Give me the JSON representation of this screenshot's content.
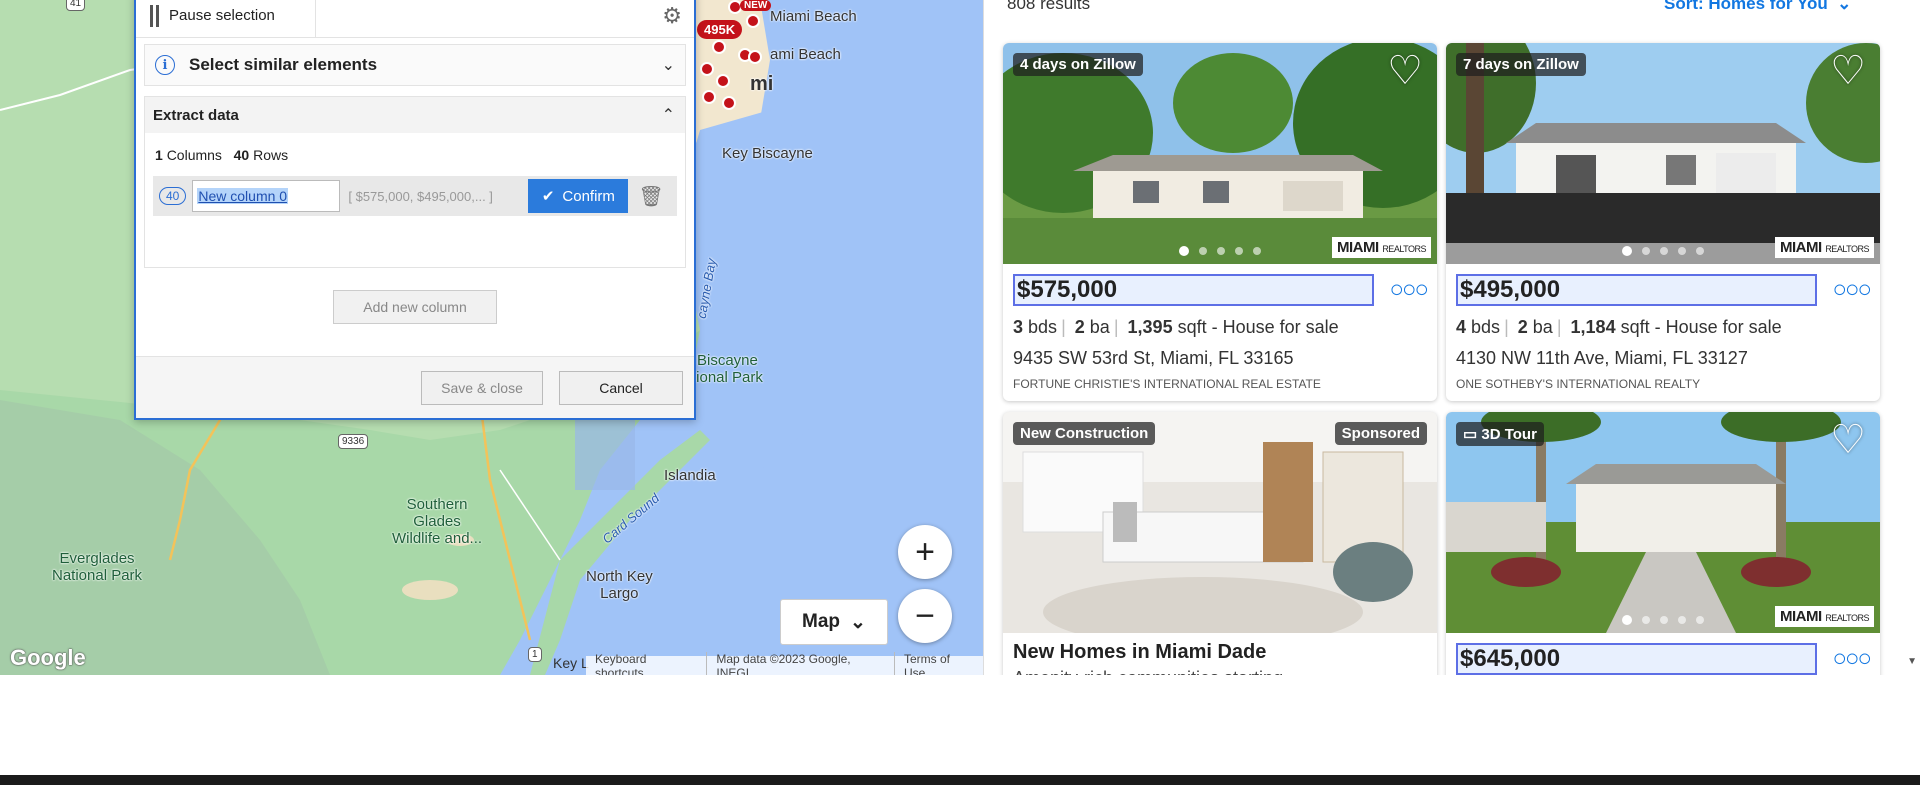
{
  "map": {
    "labels": {
      "miami_beach": "Miami Beach",
      "north_miami_beach": "ami Beach",
      "miami": "mi",
      "key_biscayne": "Key Biscayne",
      "biscayne_park": "Biscayne\ntional Park",
      "bay": "cayne Bay",
      "islandia": "Islandia",
      "southern_glades": "Southern\nGlades\nWildlife and...",
      "everglades": "Everglades\nNational Park",
      "card_sound": "Card Sound",
      "north_key_largo": "North Key\nLargo",
      "key_largo": "Key L"
    },
    "shields": {
      "r41": "41",
      "r9336": "9336",
      "r1": "1"
    },
    "pins": {
      "p495k": "495K",
      "pnew": "NEW"
    },
    "controls": {
      "zoom_in": "+",
      "zoom_out": "−",
      "map_type": "Map"
    },
    "footer": {
      "shortcuts": "Keyboard shortcuts",
      "map_data": "Map data ©2023 Google, INEGI",
      "terms": "Terms of Use"
    },
    "logo": "Google"
  },
  "dialog": {
    "pause_label": "Pause selection",
    "similar_title": "Select similar elements",
    "extract_title": "Extract data",
    "columns_count": "1",
    "columns_label": "Columns",
    "rows_count": "40",
    "rows_label": "Rows",
    "row_badge": "40",
    "column_name": "New column 0",
    "column_preview": "[ $575,000, $495,000,... ]",
    "confirm_label": "Confirm",
    "add_column_label": "Add new column",
    "save_close_label": "Save & close",
    "cancel_label": "Cancel"
  },
  "results": {
    "count_text": "808 results",
    "sort_label": "Sort: Homes for You",
    "cards": [
      {
        "badge": "4 days on Zillow",
        "price": "$575,000",
        "beds": "3",
        "beds_label": "bds",
        "baths": "2",
        "baths_label": "ba",
        "sqft": "1,395",
        "sqft_label": "sqft - House for sale",
        "address": "9435 SW 53rd St, Miami, FL 33165",
        "broker": "FORTUNE CHRISTIE'S INTERNATIONAL REAL ESTATE",
        "logo": "MIAMI",
        "logo_small": "REALTORS"
      },
      {
        "badge": "7 days on Zillow",
        "price": "$495,000",
        "beds": "4",
        "beds_label": "bds",
        "baths": "2",
        "baths_label": "ba",
        "sqft": "1,184",
        "sqft_label": "sqft - House for sale",
        "address": "4130 NW 11th Ave, Miami, FL 33127",
        "broker": "ONE SOTHEBY'S INTERNATIONAL REALTY",
        "logo": "MIAMI",
        "logo_small": "REALTORS"
      },
      {
        "badge": "New Construction",
        "badge_right": "Sponsored",
        "title": "New Homes in Miami Dade",
        "subtitle": "Amenity-rich communities starting"
      },
      {
        "badge": "3D Tour",
        "price": "$645,000",
        "logo": "MIAMI",
        "logo_small": "REALTORS"
      }
    ]
  },
  "colors": {
    "accent": "#2b6ed4",
    "zillow_blue": "#1277e1",
    "pin_red": "#c4121a",
    "water": "#a0c3f7",
    "land": "#9fd3a7"
  },
  "icons": [
    "pause-icon",
    "gear-icon",
    "info-icon",
    "chevron-down-icon",
    "chevron-up-icon",
    "check-icon",
    "trash-icon",
    "heart-icon",
    "more-icon",
    "cube-icon",
    "zoom-in-icon",
    "zoom-out-icon"
  ]
}
